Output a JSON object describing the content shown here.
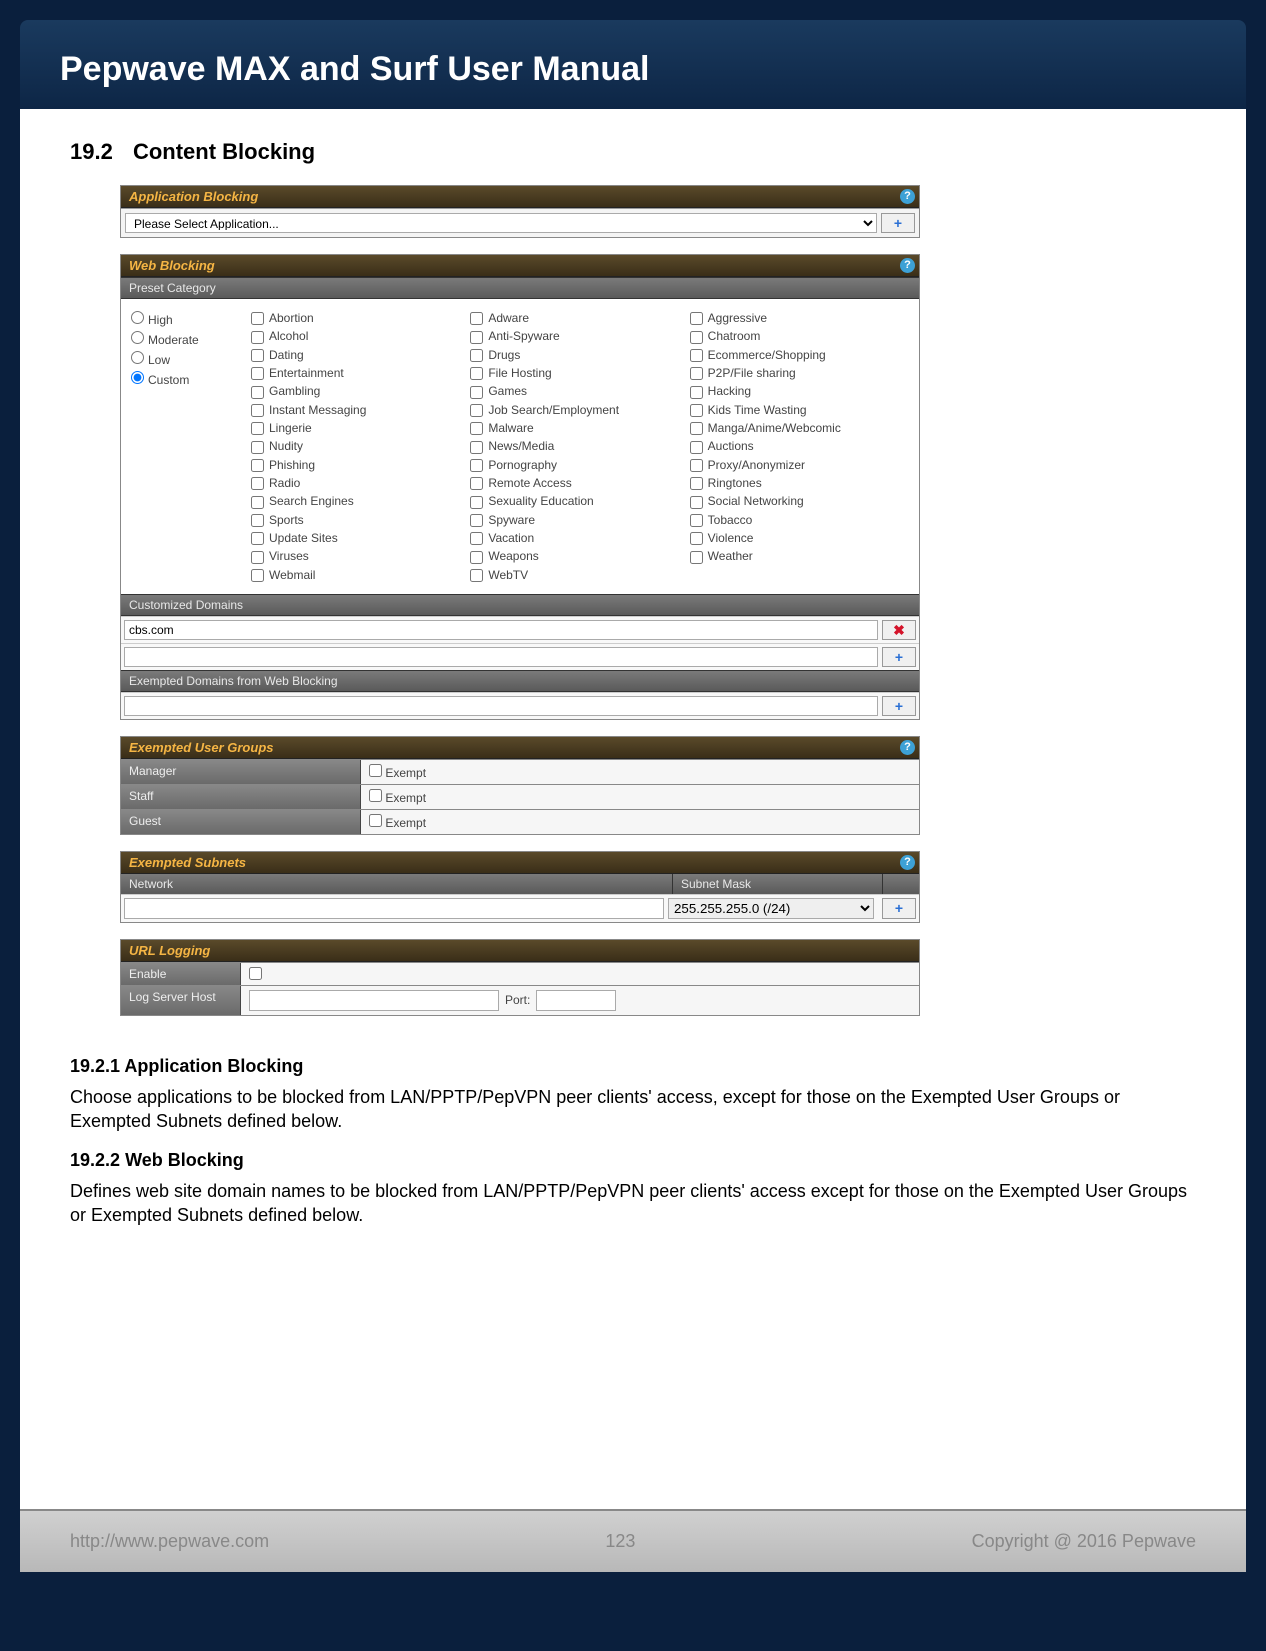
{
  "header": {
    "title": "Pepwave MAX and Surf User Manual"
  },
  "section": {
    "number": "19.2",
    "title": "Content Blocking"
  },
  "app_blocking": {
    "title": "Application Blocking",
    "select_placeholder": "Please Select Application..."
  },
  "web_blocking": {
    "title": "Web Blocking",
    "preset_label": "Preset Category",
    "radios": [
      "High",
      "Moderate",
      "Low",
      "Custom"
    ],
    "selected_radio": "Custom",
    "col1": [
      "Abortion",
      "Alcohol",
      "Dating",
      "Entertainment",
      "Gambling",
      "Instant Messaging",
      "Lingerie",
      "Nudity",
      "Phishing",
      "Radio",
      "Search Engines",
      "Sports",
      "Update Sites",
      "Viruses",
      "Webmail"
    ],
    "col2": [
      "Adware",
      "Anti-Spyware",
      "Drugs",
      "File Hosting",
      "Games",
      "Job Search/Employment",
      "Malware",
      "News/Media",
      "Pornography",
      "Remote Access",
      "Sexuality Education",
      "Spyware",
      "Vacation",
      "Weapons",
      "WebTV"
    ],
    "col3": [
      "Aggressive",
      "Chatroom",
      "Ecommerce/Shopping",
      "P2P/File sharing",
      "Hacking",
      "Kids Time Wasting",
      "Manga/Anime/Webcomic",
      "Auctions",
      "Proxy/Anonymizer",
      "Ringtones",
      "Social Networking",
      "Tobacco",
      "Violence",
      "Weather"
    ],
    "custom_domains_label": "Customized Domains",
    "custom_domain_value": "cbs.com",
    "exempted_domains_label": "Exempted Domains from Web Blocking"
  },
  "exempted_groups": {
    "title": "Exempted User Groups",
    "rows": [
      {
        "name": "Manager",
        "label": "Exempt"
      },
      {
        "name": "Staff",
        "label": "Exempt"
      },
      {
        "name": "Guest",
        "label": "Exempt"
      }
    ]
  },
  "exempted_subnets": {
    "title": "Exempted Subnets",
    "col1": "Network",
    "col2": "Subnet Mask",
    "mask_selected": "255.255.255.0 (/24)"
  },
  "url_logging": {
    "title": "URL Logging",
    "enable_label": "Enable",
    "host_label": "Log Server Host",
    "port_label": "Port:"
  },
  "subsection1": {
    "num": "19.2.1",
    "title": "Application Blocking",
    "text": "Choose applications to be blocked from LAN/PPTP/PepVPN peer clients' access, except for those on the Exempted User Groups or Exempted Subnets defined below."
  },
  "subsection2": {
    "num": "19.2.2",
    "title": "Web Blocking",
    "text": "Defines web site domain names to be blocked from LAN/PPTP/PepVPN peer clients' access except for those on the Exempted User Groups or Exempted Subnets defined below."
  },
  "footer": {
    "url": "http://www.pepwave.com",
    "page": "123",
    "copyright": "Copyright @ 2016 Pepwave"
  }
}
